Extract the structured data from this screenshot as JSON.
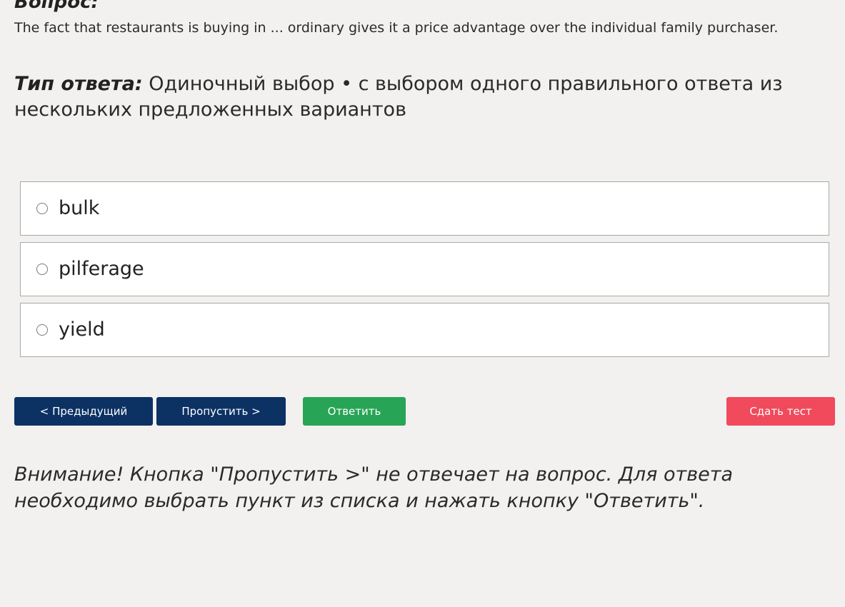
{
  "question": {
    "heading": "Вопрос:",
    "text": "The fact that restaurants is buying in ... ordinary gives it a price advantage over the individual family purchaser."
  },
  "answer_type": {
    "label": "Тип ответа:",
    "value": "Одиночный выбор • с выбором одного правильного ответа из нескольких предложенных вариантов"
  },
  "options": [
    {
      "label": "bulk",
      "selected": false
    },
    {
      "label": "pilferage",
      "selected": false
    },
    {
      "label": "yield",
      "selected": false
    }
  ],
  "buttons": {
    "previous": "< Предыдущий",
    "skip": "Пропустить >",
    "answer": "Ответить",
    "submit": "Сдать тест"
  },
  "notice": "Внимание! Кнопка \"Пропустить >\" не отвечает на вопрос. Для ответа необходимо выбрать пункт из списка и нажать кнопку \"Ответить\".",
  "colors": {
    "background": "#f2f1ef",
    "nav_button": "#0c3264",
    "answer_button": "#28a456",
    "submit_button": "#f04a5c"
  },
  "icons": {
    "radio": "radio-unchecked-icon"
  }
}
